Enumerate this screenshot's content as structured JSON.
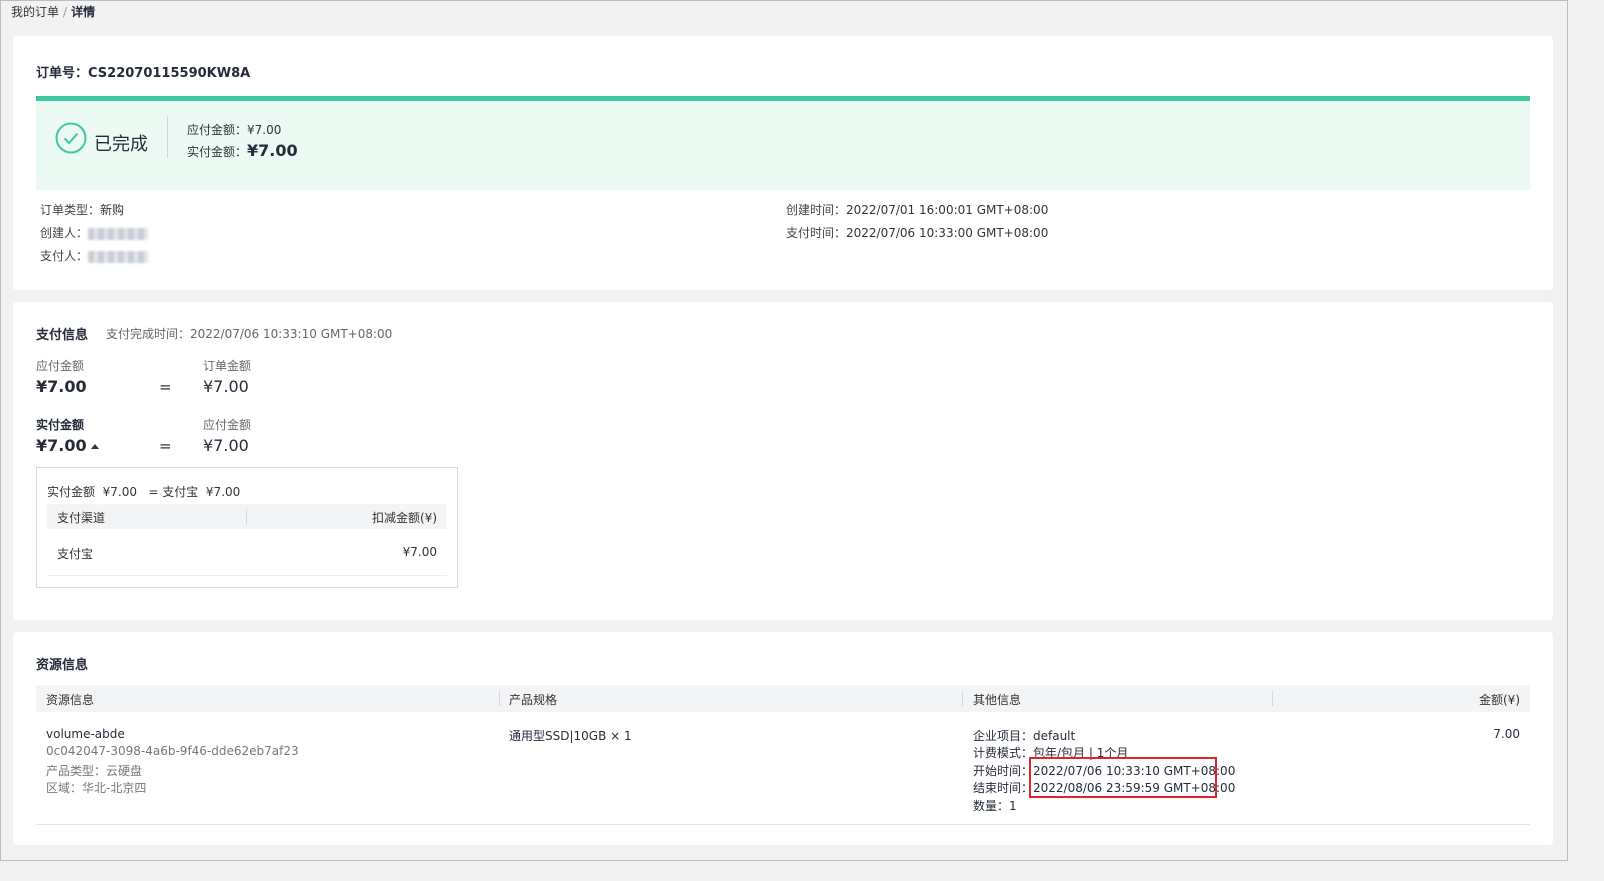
{
  "breadcrumb": {
    "parent": "我的订单",
    "separator": "/",
    "current": "详情"
  },
  "order": {
    "number_label": "订单号：",
    "number": "CS22070115590KW8A",
    "status": "已完成",
    "payable_label": "应付金额：",
    "payable": "¥7.00",
    "actual_label": "实付金额：",
    "actual": "¥7.00",
    "left_fields": [
      {
        "label": "订单类型：",
        "value": "新购"
      },
      {
        "label": "创建人：",
        "value": ""
      },
      {
        "label": "支付人：",
        "value": ""
      }
    ],
    "right_fields": [
      {
        "label": "创建时间：",
        "value": "2022/07/01 16:00:01 GMT+08:00"
      },
      {
        "label": "支付时间：",
        "value": "2022/07/06 10:33:00 GMT+08:00"
      }
    ]
  },
  "payment": {
    "title": "支付信息",
    "complete_time": "支付完成时间：2022/07/06 10:33:10 GMT+08:00",
    "row1": {
      "left_label": "应付金额",
      "left_value": "¥7.00",
      "eq": "=",
      "right_label": "订单金额",
      "right_value": "¥7.00"
    },
    "row2": {
      "left_label": "实付金额",
      "left_value": "¥7.00",
      "eq": "=",
      "right_label": "应付金额",
      "right_value": "¥7.00"
    },
    "popover": {
      "summary": "实付金额  ¥7.00   = 支付宝  ¥7.00",
      "col_channel": "支付渠道",
      "col_amount": "扣减金额(¥)",
      "rows": [
        {
          "channel": "支付宝",
          "amount": "¥7.00"
        }
      ]
    }
  },
  "resource": {
    "title": "资源信息",
    "columns": [
      "资源信息",
      "产品规格",
      "其他信息",
      "金额(¥)"
    ],
    "row": {
      "name": "volume-abde",
      "id": "0c042047-3098-4a6b-9f46-dde62eb7af23",
      "product_type": "产品类型：云硬盘",
      "region": "区域：华北-北京四",
      "spec": "通用型SSD|10GB × 1",
      "project": "企业项目：default",
      "billing": "计费模式：包年/包月 | 1个月",
      "start_label": "开始时间：",
      "start": "2022/07/06 10:33:10 GMT+08:00",
      "end_label": "结束时间：",
      "end": "2022/08/06 23:59:59 GMT+08:00",
      "quantity": "数量：1",
      "amount": "7.00"
    }
  },
  "colors": {
    "accent": "#3fc7a0",
    "status_bg": "#ebfbf4",
    "highlight": "#e0252a"
  }
}
